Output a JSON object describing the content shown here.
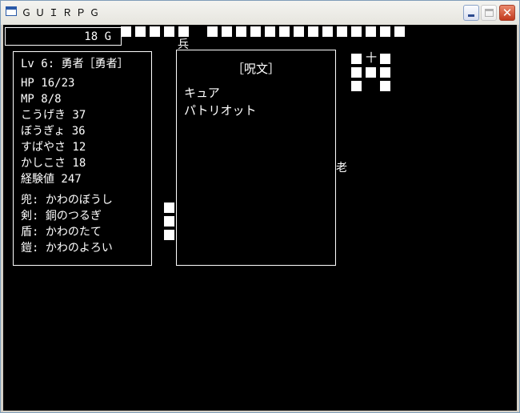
{
  "window": {
    "title": "ＧＵＩＲＰＧ"
  },
  "gold": {
    "label": "18 G"
  },
  "map": {
    "soldier": "兵",
    "old_man": "老",
    "cross": "十"
  },
  "status": {
    "header": "Lv 6: 勇者［勇者］",
    "hp": "HP 16/23",
    "mp": "MP 8/8",
    "attack": "こうげき 37",
    "defense": "ぼうぎょ 36",
    "agility": "すばやさ 12",
    "wisdom": "かしこさ 18",
    "exp": "経験値 247",
    "helmet": "兜: かわのぼうし",
    "sword": "剣: 銅のつるぎ",
    "shield": "盾: かわのたて",
    "armor": "鎧: かわのよろい"
  },
  "spells": {
    "title": "［呪文］",
    "items": [
      "キュア",
      "パトリオット"
    ]
  }
}
